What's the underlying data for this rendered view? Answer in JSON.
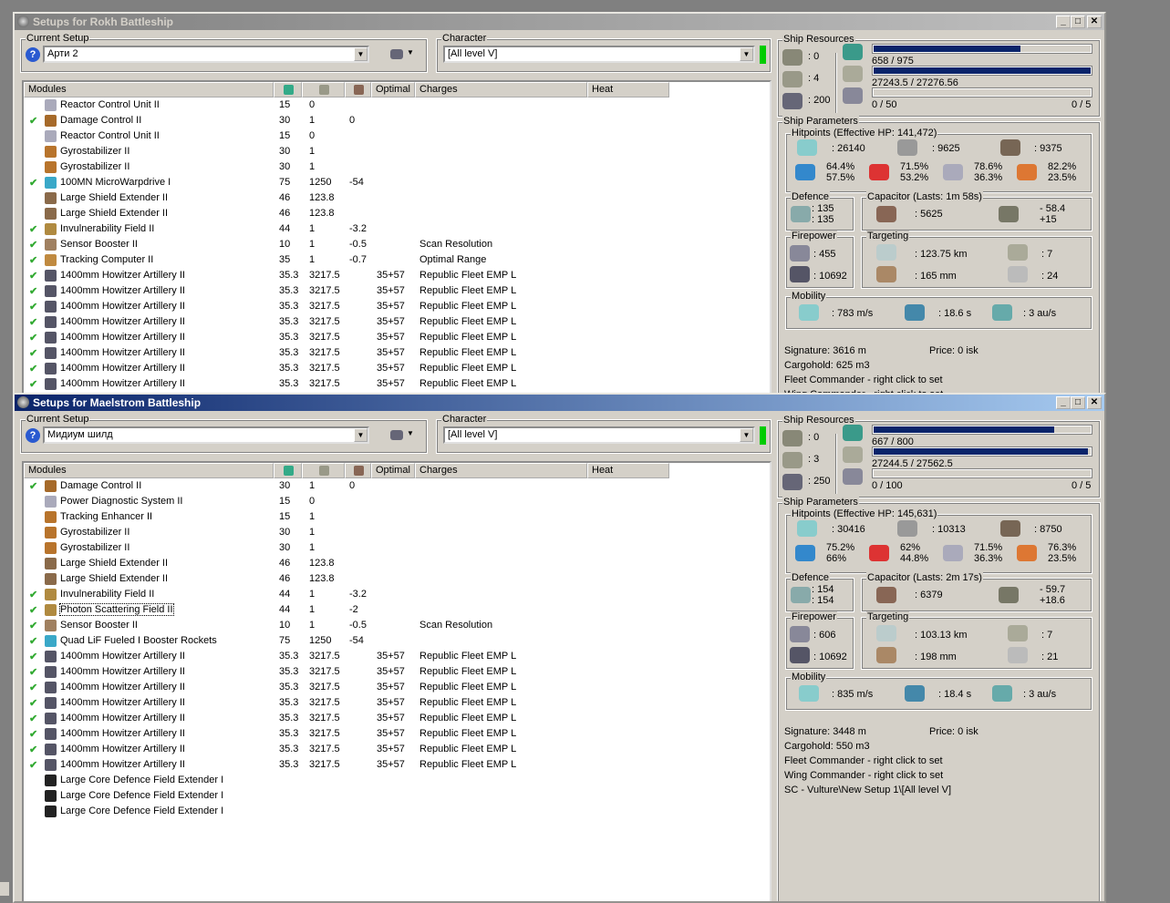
{
  "colors": {
    "active_title": "#0a246a",
    "bar_fill": "#0a246a",
    "check": "#33aa33",
    "indicator": "#00cc00"
  },
  "windows": [
    {
      "title": "Setups for Rokh Battleship",
      "active": false,
      "current_setup_label": "Current Setup",
      "current_setup": "Арти 2",
      "character_label": "Character",
      "character": "[All level V]",
      "columns": [
        "Modules",
        "cpu-icon",
        "powergrid-icon",
        "capacitor-icon",
        "Optimal",
        "Charges",
        "Heat"
      ],
      "modules": [
        {
          "check": false,
          "icon": "reactor-icon",
          "name": "Reactor Control Unit II",
          "cpu": "15",
          "pg": "0",
          "cap": "",
          "optimal": "",
          "charges": ""
        },
        {
          "check": true,
          "icon": "damage-control-icon",
          "name": "Damage Control II",
          "cpu": "30",
          "pg": "1",
          "cap": "0",
          "optimal": "",
          "charges": ""
        },
        {
          "check": false,
          "icon": "reactor-icon",
          "name": "Reactor Control Unit II",
          "cpu": "15",
          "pg": "0",
          "cap": "",
          "optimal": "",
          "charges": ""
        },
        {
          "check": false,
          "icon": "gyrostabilizer-icon",
          "name": "Gyrostabilizer II",
          "cpu": "30",
          "pg": "1",
          "cap": "",
          "optimal": "",
          "charges": ""
        },
        {
          "check": false,
          "icon": "gyrostabilizer-icon",
          "name": "Gyrostabilizer II",
          "cpu": "30",
          "pg": "1",
          "cap": "",
          "optimal": "",
          "charges": ""
        },
        {
          "check": true,
          "icon": "microwarpdrive-icon",
          "name": "100MN MicroWarpdrive I",
          "cpu": "75",
          "pg": "1250",
          "cap": "-54",
          "optimal": "",
          "charges": ""
        },
        {
          "check": false,
          "icon": "shield-extender-icon",
          "name": "Large Shield Extender II",
          "cpu": "46",
          "pg": "123.8",
          "cap": "",
          "optimal": "",
          "charges": ""
        },
        {
          "check": false,
          "icon": "shield-extender-icon",
          "name": "Large Shield Extender II",
          "cpu": "46",
          "pg": "123.8",
          "cap": "",
          "optimal": "",
          "charges": ""
        },
        {
          "check": true,
          "icon": "invulnerability-field-icon",
          "name": "Invulnerability Field II",
          "cpu": "44",
          "pg": "1",
          "cap": "-3.2",
          "optimal": "",
          "charges": ""
        },
        {
          "check": true,
          "icon": "sensor-booster-icon",
          "name": "Sensor Booster II",
          "cpu": "10",
          "pg": "1",
          "cap": "-0.5",
          "optimal": "",
          "charges": "Scan Resolution"
        },
        {
          "check": true,
          "icon": "tracking-computer-icon",
          "name": "Tracking Computer II",
          "cpu": "35",
          "pg": "1",
          "cap": "-0.7",
          "optimal": "",
          "charges": "Optimal Range"
        },
        {
          "check": true,
          "icon": "artillery-icon",
          "name": "1400mm Howitzer Artillery II",
          "cpu": "35.3",
          "pg": "3217.5",
          "cap": "",
          "optimal": "35+57",
          "charges": "Republic Fleet EMP L"
        },
        {
          "check": true,
          "icon": "artillery-icon",
          "name": "1400mm Howitzer Artillery II",
          "cpu": "35.3",
          "pg": "3217.5",
          "cap": "",
          "optimal": "35+57",
          "charges": "Republic Fleet EMP L"
        },
        {
          "check": true,
          "icon": "artillery-icon",
          "name": "1400mm Howitzer Artillery II",
          "cpu": "35.3",
          "pg": "3217.5",
          "cap": "",
          "optimal": "35+57",
          "charges": "Republic Fleet EMP L"
        },
        {
          "check": true,
          "icon": "artillery-icon",
          "name": "1400mm Howitzer Artillery II",
          "cpu": "35.3",
          "pg": "3217.5",
          "cap": "",
          "optimal": "35+57",
          "charges": "Republic Fleet EMP L"
        },
        {
          "check": true,
          "icon": "artillery-icon",
          "name": "1400mm Howitzer Artillery II",
          "cpu": "35.3",
          "pg": "3217.5",
          "cap": "",
          "optimal": "35+57",
          "charges": "Republic Fleet EMP L"
        },
        {
          "check": true,
          "icon": "artillery-icon",
          "name": "1400mm Howitzer Artillery II",
          "cpu": "35.3",
          "pg": "3217.5",
          "cap": "",
          "optimal": "35+57",
          "charges": "Republic Fleet EMP L"
        },
        {
          "check": true,
          "icon": "artillery-icon",
          "name": "1400mm Howitzer Artillery II",
          "cpu": "35.3",
          "pg": "3217.5",
          "cap": "",
          "optimal": "35+57",
          "charges": "Republic Fleet EMP L"
        },
        {
          "check": true,
          "icon": "artillery-icon",
          "name": "1400mm Howitzer Artillery II",
          "cpu": "35.3",
          "pg": "3217.5",
          "cap": "",
          "optimal": "35+57",
          "charges": "Republic Fleet EMP L"
        }
      ],
      "resources": {
        "label": "Ship Resources",
        "turrets": ": 0",
        "launchers": ": 4",
        "drone_bay": ": 200",
        "cpu_text": "658 / 975",
        "cpu_fraction": 0.675,
        "pg_text": "27243.5 / 27276.56",
        "pg_fraction": 0.999,
        "drone_text": "0 / 50",
        "drone_fraction": 0,
        "drones_active": "0 / 5"
      },
      "params": {
        "label": "Ship Parameters",
        "hp_label": "Hitpoints (Effective HP: 141,472)",
        "shield": ": 26140",
        "armor": ": 9625",
        "structure": ": 9375",
        "resists": [
          [
            "64.4%",
            "57.5%"
          ],
          [
            "71.5%",
            "53.2%"
          ],
          [
            "78.6%",
            "36.3%"
          ],
          [
            "82.2%",
            "23.5%"
          ]
        ],
        "defence_label": "Defence",
        "defence": [
          ": 135",
          ": 135"
        ],
        "cap_label": "Capacitor (Lasts: 1m 58s)",
        "cap_amount": ": 5625",
        "cap_delta": [
          "- 58.4",
          "+15"
        ],
        "firepower_label": "Firepower",
        "dps": ": 455",
        "volley": ": 10692",
        "targeting_label": "Targeting",
        "range": ": 123.75 km",
        "scanres": ": 165 mm",
        "max_targets": ": 7",
        "sensor_strength": ": 24",
        "mobility_label": "Mobility",
        "velocity": ": 783 m/s",
        "align": ": 18.6 s",
        "warp": ": 3 au/s",
        "signature": "Signature: 3616 m",
        "price": "Price: 0 isk",
        "cargo": "Cargohold: 625 m3",
        "fleet": "Fleet Commander - right click to set",
        "wing": "Wing Commander - right click to set",
        "extra": ""
      }
    },
    {
      "title": "Setups for Maelstrom Battleship",
      "active": true,
      "current_setup_label": "Current Setup",
      "current_setup": "Мидиум шилд",
      "character_label": "Character",
      "character": "[All level V]",
      "columns": [
        "Modules",
        "cpu-icon",
        "powergrid-icon",
        "capacitor-icon",
        "Optimal",
        "Charges",
        "Heat"
      ],
      "modules": [
        {
          "check": true,
          "icon": "damage-control-icon",
          "name": "Damage Control II",
          "cpu": "30",
          "pg": "1",
          "cap": "0",
          "optimal": "",
          "charges": ""
        },
        {
          "check": false,
          "icon": "reactor-icon",
          "name": "Power Diagnostic System II",
          "cpu": "15",
          "pg": "0",
          "cap": "",
          "optimal": "",
          "charges": ""
        },
        {
          "check": false,
          "icon": "gyrostabilizer-icon",
          "name": "Tracking Enhancer II",
          "cpu": "15",
          "pg": "1",
          "cap": "",
          "optimal": "",
          "charges": ""
        },
        {
          "check": false,
          "icon": "gyrostabilizer-icon",
          "name": "Gyrostabilizer II",
          "cpu": "30",
          "pg": "1",
          "cap": "",
          "optimal": "",
          "charges": ""
        },
        {
          "check": false,
          "icon": "gyrostabilizer-icon",
          "name": "Gyrostabilizer II",
          "cpu": "30",
          "pg": "1",
          "cap": "",
          "optimal": "",
          "charges": ""
        },
        {
          "check": false,
          "icon": "shield-extender-icon",
          "name": "Large Shield Extender II",
          "cpu": "46",
          "pg": "123.8",
          "cap": "",
          "optimal": "",
          "charges": ""
        },
        {
          "check": false,
          "icon": "shield-extender-icon",
          "name": "Large Shield Extender II",
          "cpu": "46",
          "pg": "123.8",
          "cap": "",
          "optimal": "",
          "charges": ""
        },
        {
          "check": true,
          "icon": "invulnerability-field-icon",
          "name": "Invulnerability Field II",
          "cpu": "44",
          "pg": "1",
          "cap": "-3.2",
          "optimal": "",
          "charges": ""
        },
        {
          "check": true,
          "icon": "invulnerability-field-icon",
          "name": "Photon Scattering Field II",
          "cpu": "44",
          "pg": "1",
          "cap": "-2",
          "optimal": "",
          "charges": "",
          "selected": true
        },
        {
          "check": true,
          "icon": "sensor-booster-icon",
          "name": "Sensor Booster II",
          "cpu": "10",
          "pg": "1",
          "cap": "-0.5",
          "optimal": "",
          "charges": "Scan Resolution"
        },
        {
          "check": true,
          "icon": "microwarpdrive-icon",
          "name": "Quad LiF Fueled I Booster Rockets",
          "cpu": "75",
          "pg": "1250",
          "cap": "-54",
          "optimal": "",
          "charges": ""
        },
        {
          "check": true,
          "icon": "artillery-icon",
          "name": "1400mm Howitzer Artillery II",
          "cpu": "35.3",
          "pg": "3217.5",
          "cap": "",
          "optimal": "35+57",
          "charges": "Republic Fleet EMP L"
        },
        {
          "check": true,
          "icon": "artillery-icon",
          "name": "1400mm Howitzer Artillery II",
          "cpu": "35.3",
          "pg": "3217.5",
          "cap": "",
          "optimal": "35+57",
          "charges": "Republic Fleet EMP L"
        },
        {
          "check": true,
          "icon": "artillery-icon",
          "name": "1400mm Howitzer Artillery II",
          "cpu": "35.3",
          "pg": "3217.5",
          "cap": "",
          "optimal": "35+57",
          "charges": "Republic Fleet EMP L"
        },
        {
          "check": true,
          "icon": "artillery-icon",
          "name": "1400mm Howitzer Artillery II",
          "cpu": "35.3",
          "pg": "3217.5",
          "cap": "",
          "optimal": "35+57",
          "charges": "Republic Fleet EMP L"
        },
        {
          "check": true,
          "icon": "artillery-icon",
          "name": "1400mm Howitzer Artillery II",
          "cpu": "35.3",
          "pg": "3217.5",
          "cap": "",
          "optimal": "35+57",
          "charges": "Republic Fleet EMP L"
        },
        {
          "check": true,
          "icon": "artillery-icon",
          "name": "1400mm Howitzer Artillery II",
          "cpu": "35.3",
          "pg": "3217.5",
          "cap": "",
          "optimal": "35+57",
          "charges": "Republic Fleet EMP L"
        },
        {
          "check": true,
          "icon": "artillery-icon",
          "name": "1400mm Howitzer Artillery II",
          "cpu": "35.3",
          "pg": "3217.5",
          "cap": "",
          "optimal": "35+57",
          "charges": "Republic Fleet EMP L"
        },
        {
          "check": true,
          "icon": "artillery-icon",
          "name": "1400mm Howitzer Artillery II",
          "cpu": "35.3",
          "pg": "3217.5",
          "cap": "",
          "optimal": "35+57",
          "charges": "Republic Fleet EMP L"
        },
        {
          "check": false,
          "icon": "core-defence-icon",
          "name": "Large Core Defence Field Extender I",
          "cpu": "",
          "pg": "",
          "cap": "",
          "optimal": "",
          "charges": ""
        },
        {
          "check": false,
          "icon": "core-defence-icon",
          "name": "Large Core Defence Field Extender I",
          "cpu": "",
          "pg": "",
          "cap": "",
          "optimal": "",
          "charges": ""
        },
        {
          "check": false,
          "icon": "core-defence-icon",
          "name": "Large Core Defence Field Extender I",
          "cpu": "",
          "pg": "",
          "cap": "",
          "optimal": "",
          "charges": ""
        }
      ],
      "resources": {
        "label": "Ship Resources",
        "turrets": ": 0",
        "launchers": ": 3",
        "drone_bay": ": 250",
        "cpu_text": "667 / 800",
        "cpu_fraction": 0.834,
        "pg_text": "27244.5 / 27562.5",
        "pg_fraction": 0.988,
        "drone_text": "0 / 100",
        "drone_fraction": 0,
        "drones_active": "0 / 5"
      },
      "params": {
        "label": "Ship Parameters",
        "hp_label": "Hitpoints (Effective HP: 145,631)",
        "shield": ": 30416",
        "armor": ": 10313",
        "structure": ": 8750",
        "resists": [
          [
            "75.2%",
            "66%"
          ],
          [
            "62%",
            "44.8%"
          ],
          [
            "71.5%",
            "36.3%"
          ],
          [
            "76.3%",
            "23.5%"
          ]
        ],
        "defence_label": "Defence",
        "defence": [
          ": 154",
          ": 154"
        ],
        "cap_label": "Capacitor (Lasts: 2m 17s)",
        "cap_amount": ": 6379",
        "cap_delta": [
          "- 59.7",
          "+18.6"
        ],
        "firepower_label": "Firepower",
        "dps": ": 606",
        "volley": ": 10692",
        "targeting_label": "Targeting",
        "range": ": 103.13 km",
        "scanres": ": 198 mm",
        "max_targets": ": 7",
        "sensor_strength": ": 21",
        "mobility_label": "Mobility",
        "velocity": ": 835 m/s",
        "align": ": 18.4 s",
        "warp": ": 3 au/s",
        "signature": "Signature: 3448 m",
        "price": "Price: 0 isk",
        "cargo": "Cargohold: 550 m3",
        "fleet": "Fleet Commander - right click to set",
        "wing": "Wing Commander - right click to set",
        "extra": "SC - Vulture\\New Setup 1\\[All level V]"
      }
    }
  ]
}
